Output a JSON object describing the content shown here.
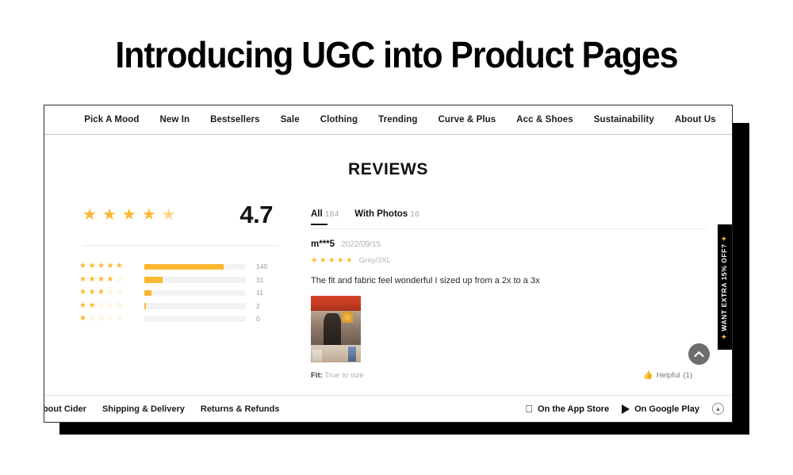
{
  "headline": "Introducing UGC into Product Pages",
  "browser": {
    "nav": {
      "items": [
        {
          "label": "Pick A Mood"
        },
        {
          "label": "New In"
        },
        {
          "label": "Bestsellers"
        },
        {
          "label": "Sale"
        },
        {
          "label": "Clothing"
        },
        {
          "label": "Trending"
        },
        {
          "label": "Curve & Plus"
        },
        {
          "label": "Acc & Shoes"
        },
        {
          "label": "Sustainability"
        },
        {
          "label": "About Us"
        }
      ]
    },
    "page_title": "REVIEWS",
    "summary": {
      "score": "4.7",
      "stars_filled": 4,
      "stars_half": 1,
      "distribution": [
        {
          "stars": 5,
          "count": "140",
          "percent": 78
        },
        {
          "stars": 4,
          "count": "31",
          "percent": 18
        },
        {
          "stars": 3,
          "count": "11",
          "percent": 7
        },
        {
          "stars": 2,
          "count": "2",
          "percent": 1.2
        },
        {
          "stars": 1,
          "count": "0",
          "percent": 0
        }
      ]
    },
    "tabs": [
      {
        "label": "All",
        "count": "184",
        "active": true
      },
      {
        "label": "With Photos",
        "count": "16",
        "active": false
      }
    ],
    "review": {
      "author": "m***5",
      "date": "2022/09/15",
      "rating": 5,
      "variant": "Grey/3XL",
      "text": "The fit and fabric feel wonderful I sized up from a 2x to a 3x",
      "photo_alt": "customer-photo",
      "fit_label": "Fit:",
      "fit_value": "True to size",
      "helpful_label": "Helpful",
      "helpful_count": "(1)",
      "thumb_icon": "thumbs-up-icon"
    },
    "footer": {
      "links": [
        {
          "label": "About Cider"
        },
        {
          "label": "Shipping & Delivery"
        },
        {
          "label": "Returns & Refunds"
        }
      ],
      "app_store": "On the App Store",
      "google_play": "On Google Play",
      "scroll_icon": "chevron-up-icon"
    },
    "promo_tab": {
      "sparkle_left": "✦",
      "text": "WANT EXTRA 15% OFF?",
      "sparkle_right": "✦"
    },
    "scroll_top_icon": "chevron-up-icon"
  },
  "colors": {
    "accent": "#FCB731",
    "track": "#f2f2f2",
    "black": "#000000",
    "muted": "#b0b0b0"
  }
}
